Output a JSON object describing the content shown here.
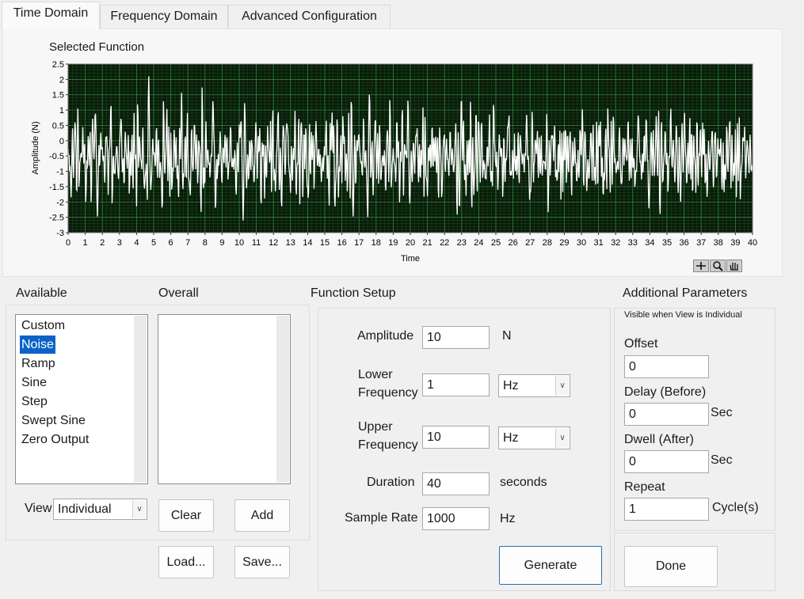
{
  "tabs": [
    {
      "label": "Time Domain",
      "active": true
    },
    {
      "label": "Frequency Domain",
      "active": false
    },
    {
      "label": "Advanced Configuration",
      "active": false
    }
  ],
  "graph": {
    "title": "Selected Function",
    "xlabel": "Time",
    "ylabel": "Amplitude (N)",
    "bg_color": "#0a1a0a",
    "grid_color": "#2e8b3a",
    "trace_color": "#ffffff",
    "palette_icons": [
      "crosshair-icon",
      "zoom-icon",
      "pan-hand-icon"
    ]
  },
  "chart_data": {
    "type": "line",
    "title": "Selected Function",
    "xlabel": "Time",
    "ylabel": "Amplitude (N)",
    "xlim": [
      0,
      40
    ],
    "ylim": [
      -3,
      2.5
    ],
    "x_ticks": [
      0,
      1,
      2,
      3,
      4,
      5,
      6,
      7,
      8,
      9,
      10,
      11,
      12,
      13,
      14,
      15,
      16,
      17,
      18,
      19,
      20,
      21,
      22,
      23,
      24,
      25,
      26,
      27,
      28,
      29,
      30,
      31,
      32,
      33,
      34,
      35,
      36,
      37,
      38,
      39,
      40
    ],
    "y_ticks": [
      2.5,
      2,
      1.5,
      1,
      0.5,
      0,
      -0.5,
      -1,
      -1.5,
      -2,
      -2.5,
      -3
    ],
    "grid": true,
    "series": [
      {
        "description": "random noise, band 1-10 Hz",
        "peak_range": [
          -2.6,
          2.1
        ]
      }
    ]
  },
  "available": {
    "label": "Available",
    "items": [
      "Custom",
      "Noise",
      "Ramp",
      "Sine",
      "Step",
      "Swept Sine",
      "Zero Output"
    ],
    "selected": "Noise"
  },
  "overall": {
    "label": "Overall",
    "items": []
  },
  "view": {
    "label": "View",
    "value": "Individual"
  },
  "buttons": {
    "clear": "Clear",
    "add": "Add",
    "load": "Load...",
    "save": "Save...",
    "generate": "Generate",
    "done": "Done"
  },
  "function_setup": {
    "label": "Function Setup",
    "amplitude": {
      "label": "Amplitude",
      "value": "10",
      "unit": "N"
    },
    "lower_frequency": {
      "label_line1": "Lower",
      "label_line2": "Frequency",
      "value": "1",
      "unit": "Hz"
    },
    "upper_frequency": {
      "label_line1": "Upper",
      "label_line2": "Frequency",
      "value": "10",
      "unit": "Hz"
    },
    "duration": {
      "label": "Duration",
      "value": "40",
      "unit": "seconds"
    },
    "sample_rate": {
      "label": "Sample Rate",
      "value": "1000",
      "unit": "Hz"
    }
  },
  "additional": {
    "label": "Additional Parameters",
    "note": "Visible when View is Individual",
    "offset": {
      "label": "Offset",
      "value": "0"
    },
    "delay": {
      "label": "Delay (Before)",
      "value": "0",
      "unit": "Sec"
    },
    "dwell": {
      "label": "Dwell (After)",
      "value": "0",
      "unit": "Sec"
    },
    "repeat": {
      "label": "Repeat",
      "value": "1",
      "unit": "Cycle(s)"
    }
  }
}
